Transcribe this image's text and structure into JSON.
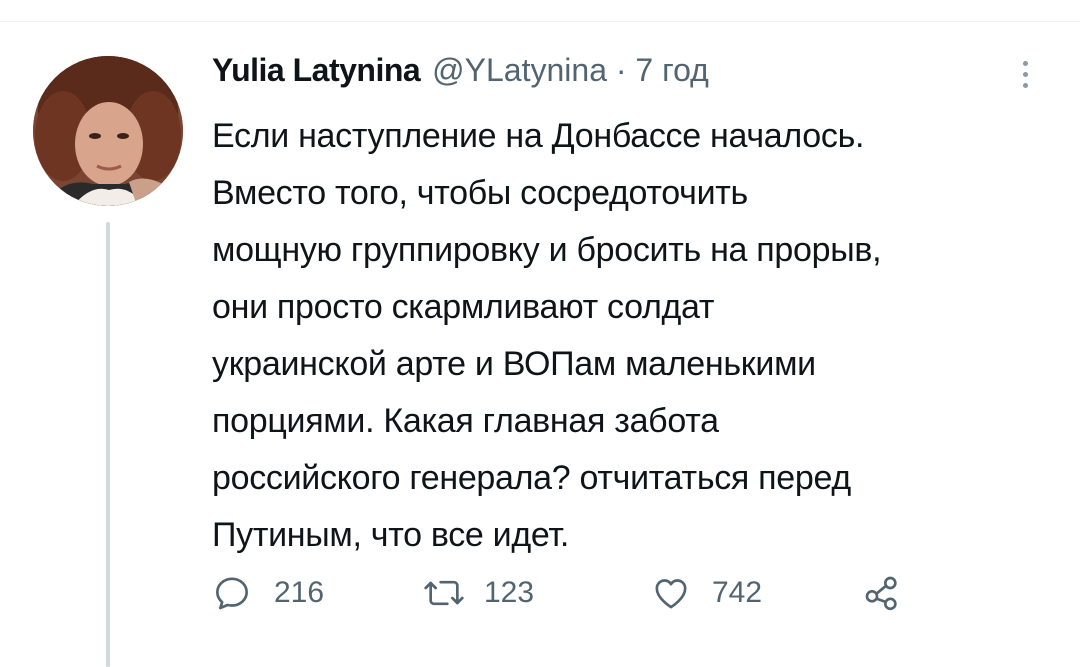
{
  "tweet": {
    "author_name": "Yulia Latynina",
    "handle": "@YLatynina",
    "separator": "·",
    "time": "7 год",
    "text": "Если наступление на Донбассе началось.\nВместо того, чтобы сосредоточить\nмощную группировку и бросить на прорыв,\nони просто скармливают солдат\nукраинской арте и ВОПам маленькими\nпорциями. Какая главная забота\nроссийского генерала? отчитаться перед\nПутиным, что все идет."
  },
  "actions": {
    "replies": "216",
    "retweets": "123",
    "likes": "742"
  },
  "icons": {
    "reply": "reply-icon",
    "retweet": "retweet-icon",
    "like": "heart-icon",
    "share": "share-icon",
    "more": "more-options-icon"
  },
  "colors": {
    "text": "#0f1419",
    "secondary": "#536471",
    "divider": "#eff3f4",
    "thread_line": "#cfd9de"
  }
}
